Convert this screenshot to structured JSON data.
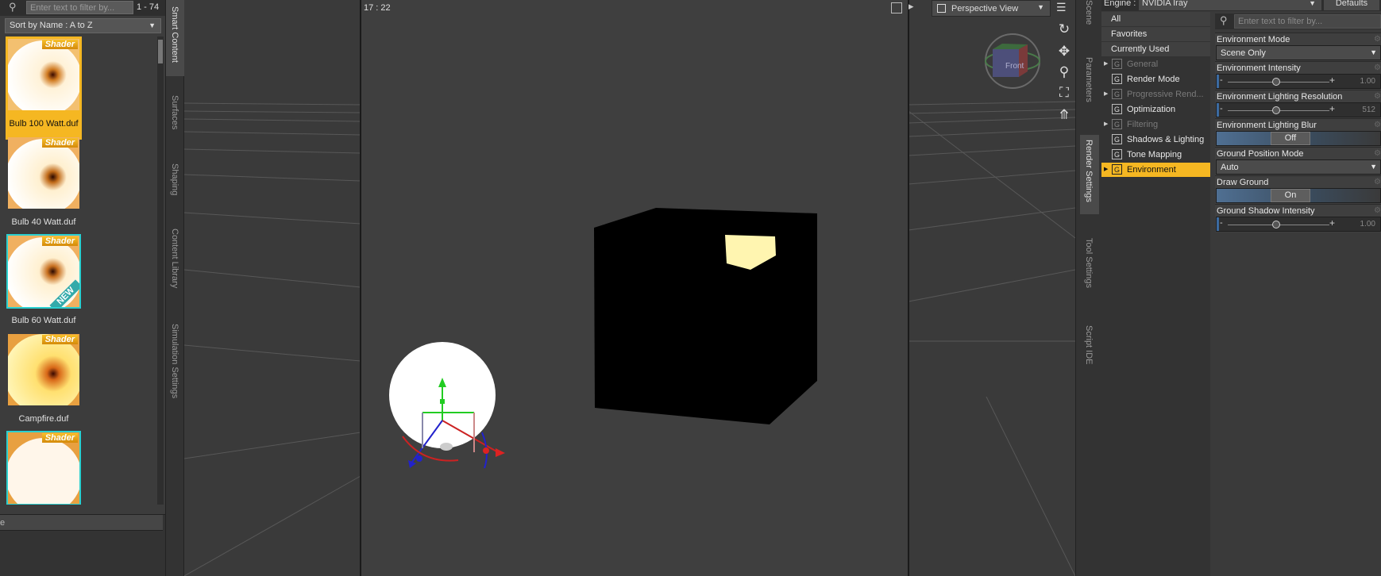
{
  "left_pane": {
    "filter_placeholder": "Enter text to filter by...",
    "item_count": "1 - 74",
    "sort_label": "Sort by Name : A to Z",
    "items": [
      {
        "label": "Bulb 100 Watt.duf",
        "badge": "Shader",
        "selected": true
      },
      {
        "label": "Bulb 40 Watt.duf",
        "badge": "Shader",
        "selected": false
      },
      {
        "label": "Bulb 60 Watt.duf",
        "badge": "Shader",
        "new_badge": "NEW",
        "selected": false
      },
      {
        "label": "Campfire.duf",
        "badge": "Shader",
        "selected": false
      },
      {
        "label": "",
        "badge": "Shader",
        "selected": false
      }
    ],
    "bottom_tab_label": "e"
  },
  "left_tabs": [
    "Smart Content",
    "Surfaces",
    "Shaping",
    "Content Library",
    "Simulation Settings"
  ],
  "viewport": {
    "aspect_ratio": "17 : 22",
    "view_name": "Perspective View",
    "cube_label": "Front"
  },
  "right_tabs": [
    "Scene",
    "Parameters",
    "Render Settings",
    "Tool Settings",
    "Script IDE"
  ],
  "render_settings": {
    "engine_label": "Engine :",
    "engine_value": "NVIDIA Iray",
    "defaults_label": "Defaults",
    "top_groups": [
      "All",
      "Favorites",
      "Currently Used"
    ],
    "groups": [
      {
        "label": "General",
        "dim": true,
        "expandable": true
      },
      {
        "label": "Render Mode",
        "dim": false,
        "expandable": false
      },
      {
        "label": "Progressive Rend...",
        "dim": true,
        "expandable": true
      },
      {
        "label": "Optimization",
        "dim": false,
        "expandable": false
      },
      {
        "label": "Filtering",
        "dim": true,
        "expandable": true
      },
      {
        "label": "Shadows & Lighting",
        "dim": false,
        "expandable": false
      },
      {
        "label": "Tone Mapping",
        "dim": false,
        "expandable": false
      },
      {
        "label": "Environment",
        "dim": false,
        "expandable": true,
        "active": true
      }
    ],
    "group_icon": "G",
    "filter_placeholder": "Enter text to filter by...",
    "properties": {
      "env_mode": {
        "label": "Environment Mode",
        "value": "Scene Only"
      },
      "env_intensity": {
        "label": "Environment Intensity",
        "value": "1.00",
        "level": 0.5
      },
      "env_resolution": {
        "label": "Environment Lighting Resolution",
        "value": "512",
        "level": 0.5
      },
      "env_blur": {
        "label": "Environment Lighting Blur",
        "value": "Off"
      },
      "ground_mode": {
        "label": "Ground Position Mode",
        "value": "Auto"
      },
      "draw_ground": {
        "label": "Draw Ground",
        "value": "On"
      },
      "ground_shadow": {
        "label": "Ground Shadow Intensity",
        "value": "1.00",
        "level": 0.5
      }
    }
  },
  "colors": {
    "accent": "#f5b722",
    "panel": "#3a3a3a",
    "viewport": "#3f3f3f"
  }
}
